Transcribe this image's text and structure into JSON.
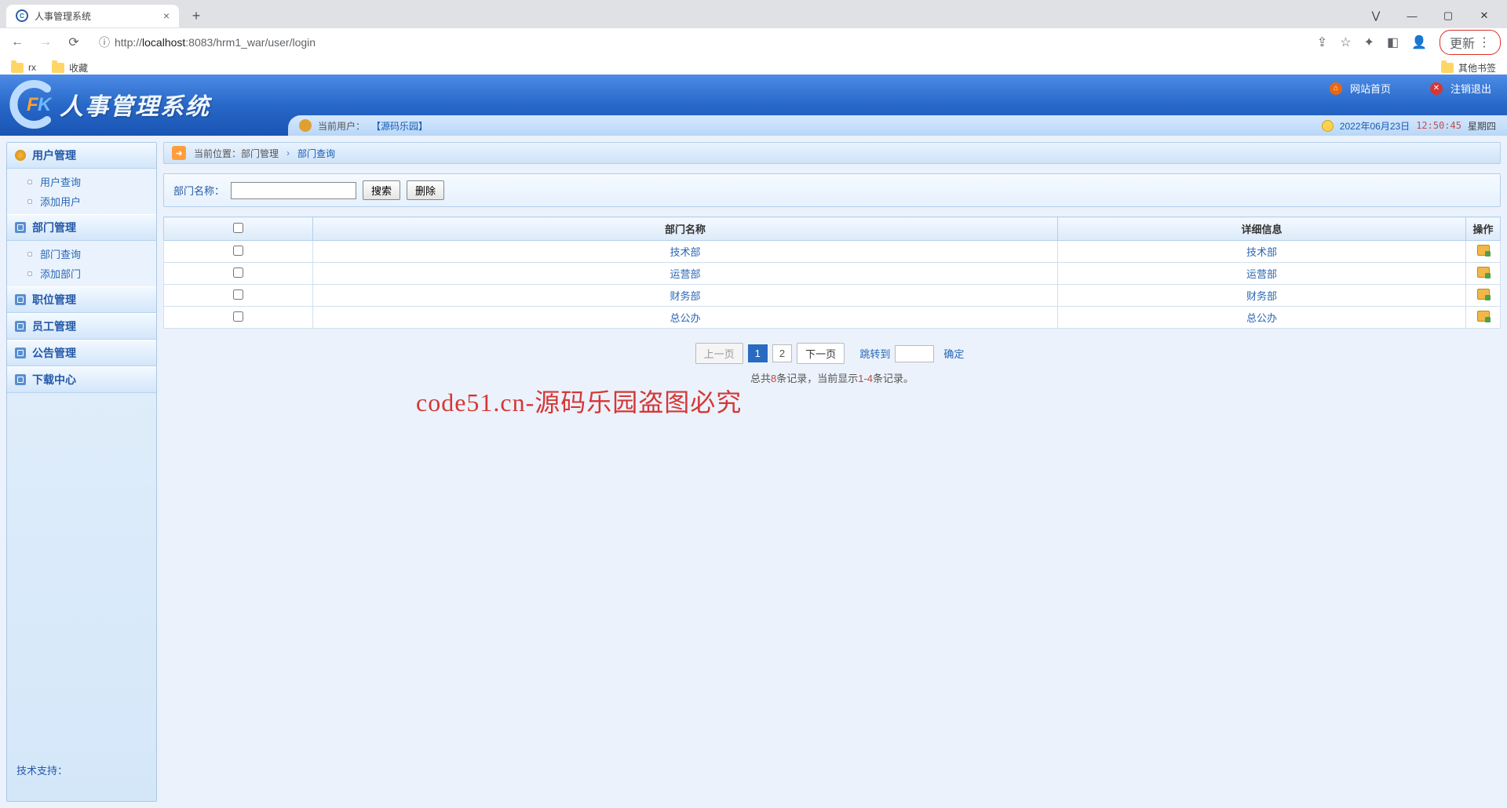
{
  "browser": {
    "tab_title": "人事管理系统",
    "url_prefix": "http://",
    "url_host": "localhost",
    "url_path": ":8083/hrm1_war/user/login",
    "update_label": "更新",
    "bookmarks": [
      "rx",
      "收藏"
    ],
    "other_bookmarks": "其他书签"
  },
  "header": {
    "system_name": "人事管理系统",
    "logo_letters": "FK",
    "home_link": "网站首页",
    "logout_link": "注销退出",
    "current_user_label": "当前用户：",
    "current_user": "【源码乐园】",
    "date": "2022年06月23日",
    "time": "12:50:45",
    "weekday": "星期四"
  },
  "sidebar": {
    "groups": [
      {
        "title": "用户管理",
        "items": [
          "用户查询",
          "添加用户"
        ]
      },
      {
        "title": "部门管理",
        "items": [
          "部门查询",
          "添加部门"
        ]
      },
      {
        "title": "职位管理",
        "items": []
      },
      {
        "title": "员工管理",
        "items": []
      },
      {
        "title": "公告管理",
        "items": []
      },
      {
        "title": "下载中心",
        "items": []
      }
    ],
    "support_label": "技术支持："
  },
  "breadcrumb": {
    "label": "当前位置：",
    "level1": "部门管理",
    "level2": "部门查询"
  },
  "search": {
    "label": "部门名称：",
    "search_btn": "搜索",
    "delete_btn": "删除"
  },
  "table": {
    "headers": {
      "name": "部门名称",
      "detail": "详细信息",
      "action": "操作"
    },
    "rows": [
      {
        "name": "技术部",
        "detail": "技术部"
      },
      {
        "name": "运营部",
        "detail": "运营部"
      },
      {
        "name": "财务部",
        "detail": "财务部"
      },
      {
        "name": "总公办",
        "detail": "总公办"
      }
    ]
  },
  "pagination": {
    "prev": "上一页",
    "next": "下一页",
    "pages": [
      "1",
      "2"
    ],
    "goto_label": "跳转到",
    "confirm": "确定",
    "info_prefix": "总共",
    "info_total": "8",
    "info_mid": "条记录，当前显示",
    "info_range": "1-4",
    "info_suffix": "条记录。"
  },
  "watermark": "code51.cn-源码乐园盗图必究"
}
